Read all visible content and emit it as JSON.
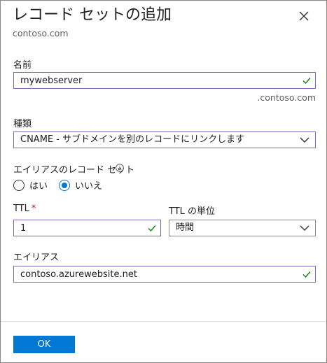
{
  "header": {
    "title": "レコード セットの追加",
    "subtitle": "contoso.com",
    "close_icon": "close-icon"
  },
  "name": {
    "label": "名前",
    "value": "mywebserver",
    "suffix": ".contoso.com"
  },
  "type": {
    "label": "種類",
    "selected": "CNAME - サブドメインを別のレコードにリンクします"
  },
  "alias_record_set": {
    "label": "エイリアスのレコード セット",
    "info_icon": "info-icon",
    "options": [
      "はい",
      "いいえ"
    ],
    "selected": "いいえ"
  },
  "ttl": {
    "label": "TTL",
    "required_mark": "*",
    "value": "1"
  },
  "ttl_unit": {
    "label": "TTL の単位",
    "selected": "時間"
  },
  "alias": {
    "label": "エイリアス",
    "value": "contoso.azurewebsite.net"
  },
  "footer": {
    "ok_label": "OK"
  },
  "colors": {
    "accent": "#0078d4",
    "valid_border": "#8764b8",
    "check": "#107c10",
    "required": "#a4262c"
  }
}
